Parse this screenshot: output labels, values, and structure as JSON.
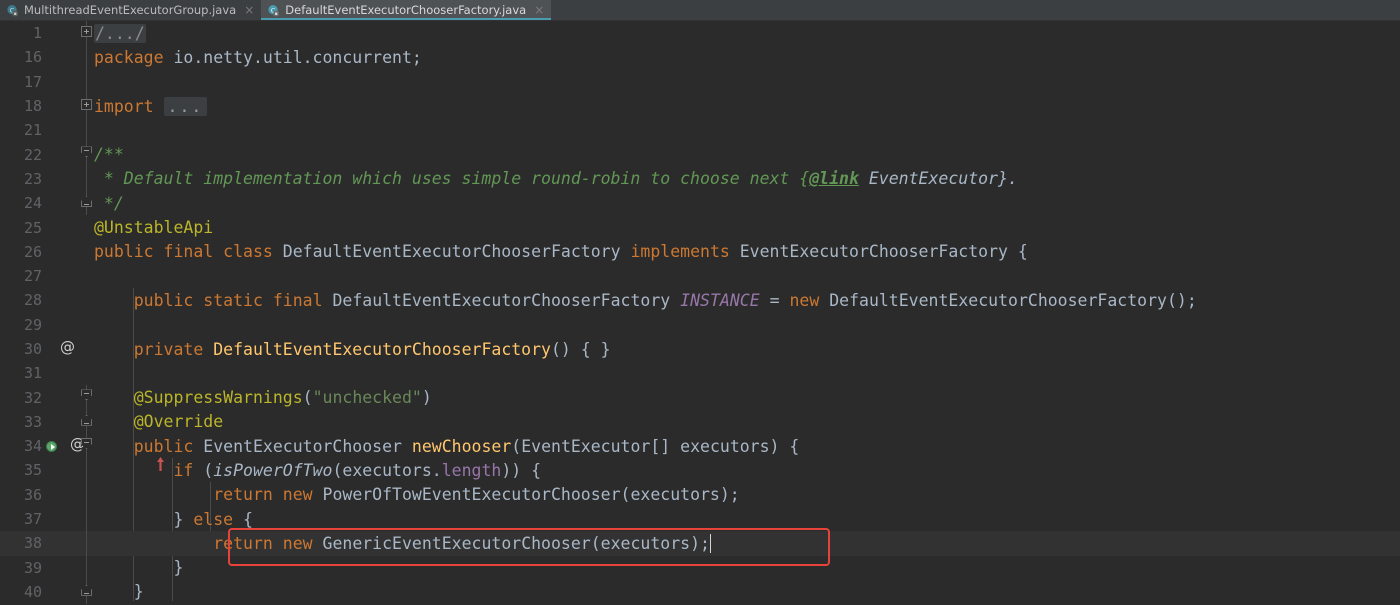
{
  "window": {
    "theme_background": "#2b2b2b",
    "accent": "#4a9ab0",
    "annotation_color": "#e8433a"
  },
  "tabs": [
    {
      "label": "MultithreadEventExecutorGroup.java",
      "active": false,
      "icon": "java-class-file-icon",
      "close_glyph": "×"
    },
    {
      "label": "DefaultEventExecutorChooserFactory.java",
      "active": true,
      "icon": "java-class-file-icon",
      "close_glyph": "×"
    }
  ],
  "editor": {
    "language": "Java",
    "caret_line_number": "38",
    "lines": [
      {
        "num": "1",
        "fold": "plus",
        "marker": "",
        "indent": 0,
        "text": "/.../"
      },
      {
        "num": "16",
        "fold": "line",
        "marker": "",
        "indent": 0,
        "text": "package io.netty.util.concurrent;"
      },
      {
        "num": "17",
        "fold": "line",
        "marker": "",
        "indent": 0,
        "text": ""
      },
      {
        "num": "18",
        "fold": "plus",
        "marker": "",
        "indent": 0,
        "text": "import ..."
      },
      {
        "num": "21",
        "fold": "line",
        "marker": "",
        "indent": 0,
        "text": ""
      },
      {
        "num": "22",
        "fold": "down",
        "marker": "",
        "indent": 0,
        "text": "/**"
      },
      {
        "num": "23",
        "fold": "line",
        "marker": "",
        "indent": 0,
        "text": " * Default implementation which uses simple round-robin to choose next {@link EventExecutor}."
      },
      {
        "num": "24",
        "fold": "up",
        "marker": "",
        "indent": 0,
        "text": " */"
      },
      {
        "num": "25",
        "fold": "none",
        "marker": "",
        "indent": 0,
        "text": "@UnstableApi"
      },
      {
        "num": "26",
        "fold": "none",
        "marker": "",
        "indent": 0,
        "text": "public final class DefaultEventExecutorChooserFactory implements EventExecutorChooserFactory {"
      },
      {
        "num": "27",
        "fold": "none",
        "marker": "",
        "indent": 0,
        "text": ""
      },
      {
        "num": "28",
        "fold": "none",
        "marker": "",
        "indent": 1,
        "text": "    public static final DefaultEventExecutorChooserFactory INSTANCE = new DefaultEventExecutorChooserFactory();"
      },
      {
        "num": "29",
        "fold": "none",
        "marker": "",
        "indent": 1,
        "text": ""
      },
      {
        "num": "30",
        "fold": "none",
        "marker": "at",
        "indent": 1,
        "text": "    private DefaultEventExecutorChooserFactory() { }"
      },
      {
        "num": "31",
        "fold": "none",
        "marker": "",
        "indent": 1,
        "text": ""
      },
      {
        "num": "32",
        "fold": "down",
        "marker": "",
        "indent": 1,
        "text": "    @SuppressWarnings(\"unchecked\")"
      },
      {
        "num": "33",
        "fold": "up",
        "marker": "",
        "indent": 1,
        "text": "    @Override"
      },
      {
        "num": "34",
        "fold": "down",
        "marker": "run-impl-at",
        "indent": 1,
        "text": "    public EventExecutorChooser newChooser(EventExecutor[] executors) {"
      },
      {
        "num": "35",
        "fold": "none",
        "marker": "",
        "indent": 2,
        "text": "        if (isPowerOfTwo(executors.length)) {"
      },
      {
        "num": "36",
        "fold": "none",
        "marker": "",
        "indent": 3,
        "text": "            return new PowerOfTowEventExecutorChooser(executors);"
      },
      {
        "num": "37",
        "fold": "none",
        "marker": "",
        "indent": 2,
        "text": "        } else {"
      },
      {
        "num": "38",
        "fold": "none",
        "marker": "",
        "indent": 3,
        "text": "            return new GenericEventExecutorChooser(executors);"
      },
      {
        "num": "39",
        "fold": "none",
        "marker": "",
        "indent": 2,
        "text": "        }"
      },
      {
        "num": "40",
        "fold": "up",
        "marker": "",
        "indent": 1,
        "text": "    }"
      }
    ],
    "gutter_markers": {
      "at_symbol": "@",
      "run_icon": "run-gutter-icon",
      "implementation_arrow_icon": "implemented-method-arrow-icon"
    },
    "annotation": {
      "type": "red-rectangle-highlight",
      "target_line": "38",
      "target_text": "return new GenericEventExecutorChooser(executors);"
    }
  }
}
